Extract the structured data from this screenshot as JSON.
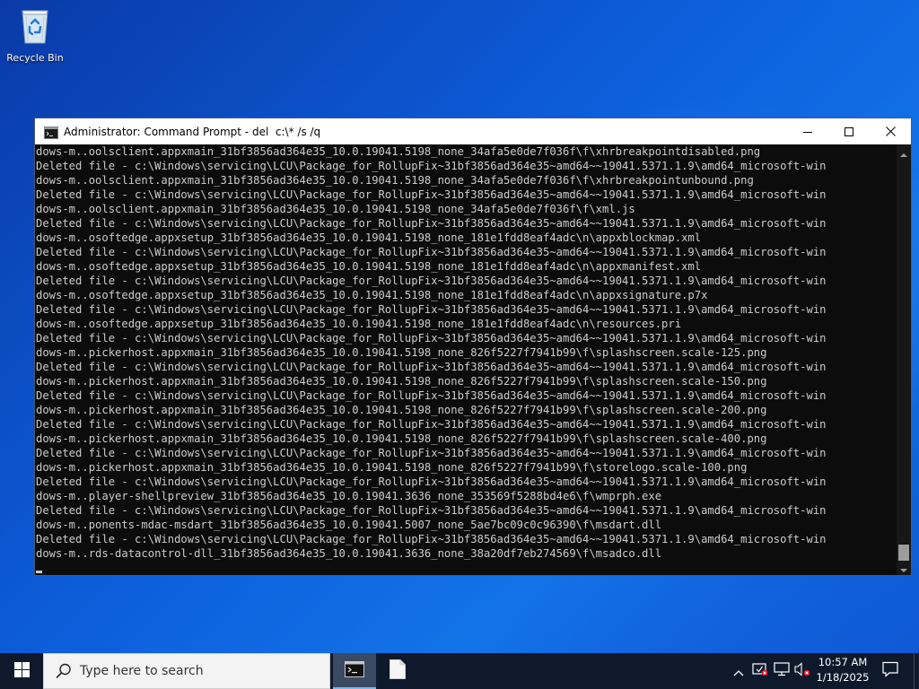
{
  "desktop": {
    "icons": [
      {
        "label": "Recycle Bin",
        "icon": "recycle-bin-icon"
      }
    ]
  },
  "window": {
    "title": "Administrator: Command Prompt - del  c:\\* /s /q",
    "app_icon": "command-prompt-icon",
    "controls": {
      "minimize": "minimize-icon",
      "maximize": "maximize-icon",
      "close": "close-icon"
    },
    "lines": [
      "dows-m..oolsclient.appxmain_31bf3856ad364e35_10.0.19041.5198_none_34afa5e0de7f036f\\f\\xhrbreakpointdisabled.png",
      "Deleted file - c:\\Windows\\servicing\\LCU\\Package_for_RollupFix~31bf3856ad364e35~amd64~~19041.5371.1.9\\amd64_microsoft-win",
      "dows-m..oolsclient.appxmain_31bf3856ad364e35_10.0.19041.5198_none_34afa5e0de7f036f\\f\\xhrbreakpointunbound.png",
      "Deleted file - c:\\Windows\\servicing\\LCU\\Package_for_RollupFix~31bf3856ad364e35~amd64~~19041.5371.1.9\\amd64_microsoft-win",
      "dows-m..oolsclient.appxmain_31bf3856ad364e35_10.0.19041.5198_none_34afa5e0de7f036f\\f\\xml.js",
      "Deleted file - c:\\Windows\\servicing\\LCU\\Package_for_RollupFix~31bf3856ad364e35~amd64~~19041.5371.1.9\\amd64_microsoft-win",
      "dows-m..osoftedge.appxsetup_31bf3856ad364e35_10.0.19041.5198_none_181e1fdd8eaf4adc\\n\\appxblockmap.xml",
      "Deleted file - c:\\Windows\\servicing\\LCU\\Package_for_RollupFix~31bf3856ad364e35~amd64~~19041.5371.1.9\\amd64_microsoft-win",
      "dows-m..osoftedge.appxsetup_31bf3856ad364e35_10.0.19041.5198_none_181e1fdd8eaf4adc\\n\\appxmanifest.xml",
      "Deleted file - c:\\Windows\\servicing\\LCU\\Package_for_RollupFix~31bf3856ad364e35~amd64~~19041.5371.1.9\\amd64_microsoft-win",
      "dows-m..osoftedge.appxsetup_31bf3856ad364e35_10.0.19041.5198_none_181e1fdd8eaf4adc\\n\\appxsignature.p7x",
      "Deleted file - c:\\Windows\\servicing\\LCU\\Package_for_RollupFix~31bf3856ad364e35~amd64~~19041.5371.1.9\\amd64_microsoft-win",
      "dows-m..osoftedge.appxsetup_31bf3856ad364e35_10.0.19041.5198_none_181e1fdd8eaf4adc\\n\\resources.pri",
      "Deleted file - c:\\Windows\\servicing\\LCU\\Package_for_RollupFix~31bf3856ad364e35~amd64~~19041.5371.1.9\\amd64_microsoft-win",
      "dows-m..pickerhost.appxmain_31bf3856ad364e35_10.0.19041.5198_none_826f5227f7941b99\\f\\splashscreen.scale-125.png",
      "Deleted file - c:\\Windows\\servicing\\LCU\\Package_for_RollupFix~31bf3856ad364e35~amd64~~19041.5371.1.9\\amd64_microsoft-win",
      "dows-m..pickerhost.appxmain_31bf3856ad364e35_10.0.19041.5198_none_826f5227f7941b99\\f\\splashscreen.scale-150.png",
      "Deleted file - c:\\Windows\\servicing\\LCU\\Package_for_RollupFix~31bf3856ad364e35~amd64~~19041.5371.1.9\\amd64_microsoft-win",
      "dows-m..pickerhost.appxmain_31bf3856ad364e35_10.0.19041.5198_none_826f5227f7941b99\\f\\splashscreen.scale-200.png",
      "Deleted file - c:\\Windows\\servicing\\LCU\\Package_for_RollupFix~31bf3856ad364e35~amd64~~19041.5371.1.9\\amd64_microsoft-win",
      "dows-m..pickerhost.appxmain_31bf3856ad364e35_10.0.19041.5198_none_826f5227f7941b99\\f\\splashscreen.scale-400.png",
      "Deleted file - c:\\Windows\\servicing\\LCU\\Package_for_RollupFix~31bf3856ad364e35~amd64~~19041.5371.1.9\\amd64_microsoft-win",
      "dows-m..pickerhost.appxmain_31bf3856ad364e35_10.0.19041.5198_none_826f5227f7941b99\\f\\storelogo.scale-100.png",
      "Deleted file - c:\\Windows\\servicing\\LCU\\Package_for_RollupFix~31bf3856ad364e35~amd64~~19041.5371.1.9\\amd64_microsoft-win",
      "dows-m..player-shellpreview_31bf3856ad364e35_10.0.19041.3636_none_353569f5288bd4e6\\f\\wmprph.exe",
      "Deleted file - c:\\Windows\\servicing\\LCU\\Package_for_RollupFix~31bf3856ad364e35~amd64~~19041.5371.1.9\\amd64_microsoft-win",
      "dows-m..ponents-mdac-msdart_31bf3856ad364e35_10.0.19041.5007_none_5ae7bc09c0c96390\\f\\msdart.dll",
      "Deleted file - c:\\Windows\\servicing\\LCU\\Package_for_RollupFix~31bf3856ad364e35~amd64~~19041.5371.1.9\\amd64_microsoft-win",
      "dows-m..rds-datacontrol-dll_31bf3856ad364e35_10.0.19041.3636_none_38a20df7eb274569\\f\\msadco.dll"
    ]
  },
  "taskbar": {
    "start_icon": "windows-logo-icon",
    "search_placeholder": "Type here to search",
    "search_icon": "search-icon",
    "apps": [
      {
        "name": "Command Prompt",
        "icon": "command-prompt-icon",
        "active": true
      },
      {
        "name": "File",
        "icon": "document-icon",
        "active": false
      }
    ],
    "tray": {
      "icons": [
        "chevron-up-icon",
        "windows-security-icon",
        "network-icon",
        "volume-muted-icon"
      ],
      "time": "10:57 AM",
      "date": "1/18/2025",
      "notification_icon": "notification-icon"
    }
  },
  "colors": {
    "console_bg": "#0c0c0c",
    "console_text": "#cccccc",
    "taskbar_bg": "#0e1a2c",
    "accent": "#76b9ed"
  }
}
